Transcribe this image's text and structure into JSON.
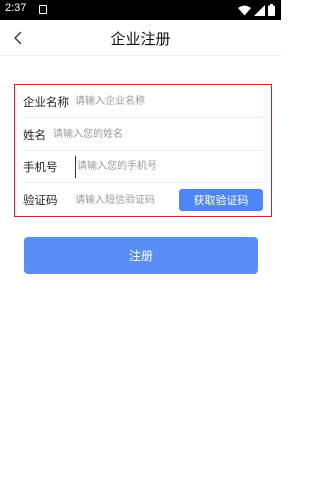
{
  "status_bar": {
    "time": "2:37",
    "icons": [
      "notification-icon",
      "wifi-icon",
      "signal-icon",
      "battery-icon"
    ]
  },
  "nav": {
    "title": "企业注册",
    "back_icon": "chevron-left-icon"
  },
  "form": {
    "border_color": "#d81e2a",
    "fields": [
      {
        "label": "企业名称",
        "value": "",
        "placeholder": "请输入企业名称"
      },
      {
        "label": "姓名",
        "value": "",
        "placeholder": "请输入您的姓名"
      },
      {
        "label": "手机号",
        "value": "",
        "placeholder": "请输入您的手机号"
      },
      {
        "label": "验证码",
        "value": "",
        "placeholder": "请输入短信验证码"
      }
    ],
    "get_code_label": "获取验证码"
  },
  "submit_label": "注册",
  "colors": {
    "accent": "#5a8ef7",
    "code_button": "#4f86f7",
    "highlight_border": "#d81e2a"
  }
}
